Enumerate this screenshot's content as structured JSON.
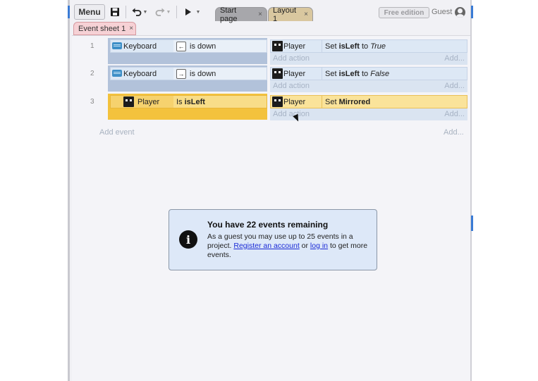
{
  "toolbar": {
    "menu_label": "Menu",
    "tabs": [
      {
        "label": "Start page"
      },
      {
        "label": "Layout 1"
      }
    ],
    "tab_close_glyph": "×",
    "edition_badge": "Free edition",
    "user_label": "Guest"
  },
  "sheet_tab": {
    "label": "Event sheet 1"
  },
  "events": [
    {
      "number": "1",
      "condition": {
        "object": "Keyboard",
        "key": "←",
        "text": "is down"
      },
      "action": {
        "object": "Player",
        "verb": "Set ",
        "bold": "isLeft",
        "mid": " to ",
        "italic": "True"
      },
      "add_action": "Add action",
      "add_more": "Add..."
    },
    {
      "number": "2",
      "condition": {
        "object": "Keyboard",
        "key": "→",
        "text": "is down"
      },
      "action": {
        "object": "Player",
        "verb": "Set ",
        "bold": "isLeft",
        "mid": " to ",
        "italic": "False"
      },
      "add_action": "Add action",
      "add_more": "Add..."
    },
    {
      "number": "3",
      "condition": {
        "object": "Player",
        "text_prefix": "Is ",
        "text_bold": "isLeft"
      },
      "action": {
        "object": "Player",
        "verb": "Set ",
        "bold": "Mirrored"
      },
      "add_action": "Add action",
      "add_more": "Add..."
    }
  ],
  "add_event": "Add event",
  "add_event_more": "Add...",
  "notice": {
    "title": "You have 22 events remaining",
    "body_1": "As a guest you may use up to 25 events in a project. ",
    "register_link": "Register an account",
    "body_2": " or ",
    "login_link": "log in",
    "body_3": " to get more events."
  },
  "colors": {
    "selected_event": "#f3c23d",
    "event_bg": "#dde8f5",
    "notice_bg": "#dde8f8",
    "link": "#1a2ad6"
  }
}
